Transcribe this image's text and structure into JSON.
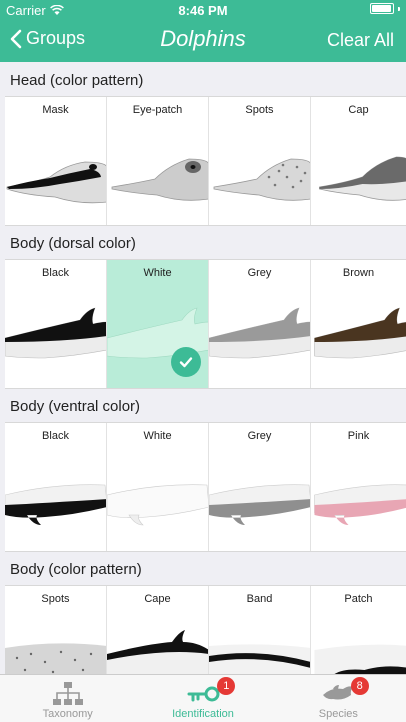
{
  "status_bar": {
    "carrier": "Carrier",
    "time": "8:46 PM"
  },
  "nav": {
    "back_label": "Groups",
    "title": "Dolphins",
    "clear_label": "Clear All"
  },
  "sections": [
    {
      "title": "Head (color pattern)",
      "options": [
        "Mask",
        "Eye-patch",
        "Spots",
        "Cap"
      ]
    },
    {
      "title": "Body (dorsal color)",
      "options": [
        "Black",
        "White",
        "Grey",
        "Brown"
      ],
      "selected": "White"
    },
    {
      "title": "Body (ventral color)",
      "options": [
        "Black",
        "White",
        "Grey",
        "Pink"
      ]
    },
    {
      "title": "Body (color pattern)",
      "options": [
        "Spots",
        "Cape",
        "Band",
        "Patch"
      ]
    }
  ],
  "tabs": [
    {
      "label": "Taxonomy",
      "icon": "hierarchy-icon"
    },
    {
      "label": "Identification",
      "icon": "key-icon",
      "badge": "1",
      "active": true
    },
    {
      "label": "Species",
      "icon": "fish-icon",
      "badge": "8"
    }
  ],
  "colors": {
    "accent": "#3dbb96",
    "selected_bg": "#b9ecd8",
    "badge": "#e53935"
  }
}
